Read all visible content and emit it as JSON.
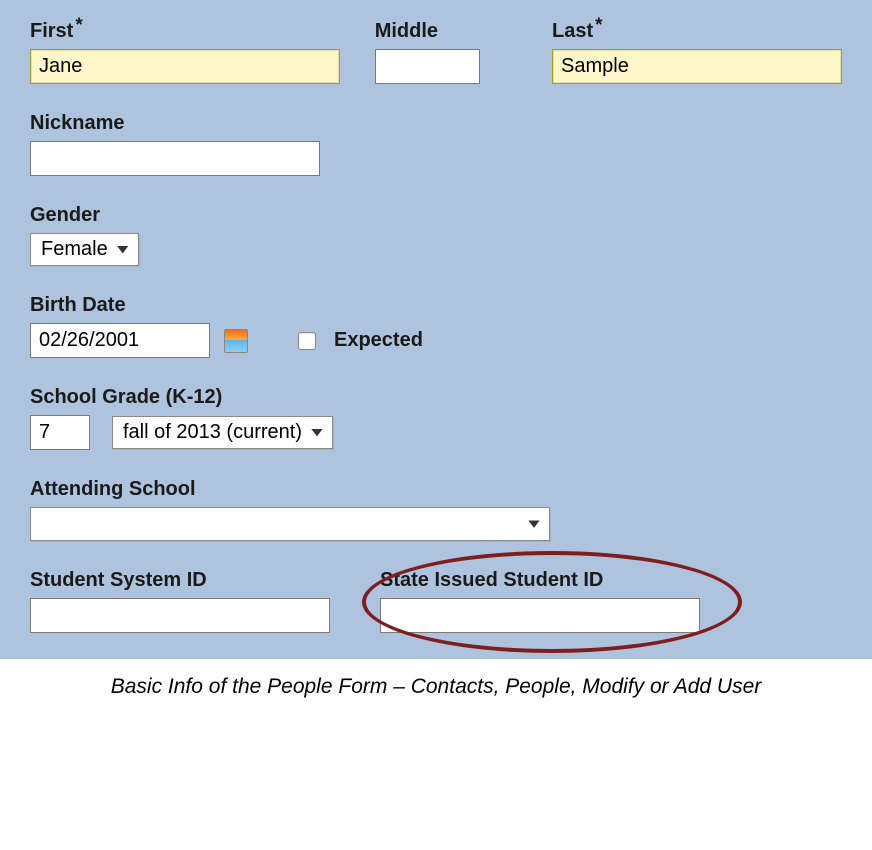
{
  "name": {
    "first_label": "First",
    "first_value": "Jane",
    "middle_label": "Middle",
    "middle_value": "",
    "last_label": "Last",
    "last_value": "Sample"
  },
  "nickname": {
    "label": "Nickname",
    "value": ""
  },
  "gender": {
    "label": "Gender",
    "selected": "Female"
  },
  "birth": {
    "label": "Birth Date",
    "value": "02/26/2001",
    "expected_label": "Expected"
  },
  "grade": {
    "label": "School Grade (K-12)",
    "value": "7",
    "term_selected": "fall of 2013 (current)"
  },
  "attending": {
    "label": "Attending School",
    "selected": ""
  },
  "ids": {
    "system_label": "Student System ID",
    "system_value": "",
    "state_label": "State Issued Student ID",
    "state_value": ""
  },
  "caption": "Basic Info of the People Form – Contacts, People, Modify or Add User"
}
